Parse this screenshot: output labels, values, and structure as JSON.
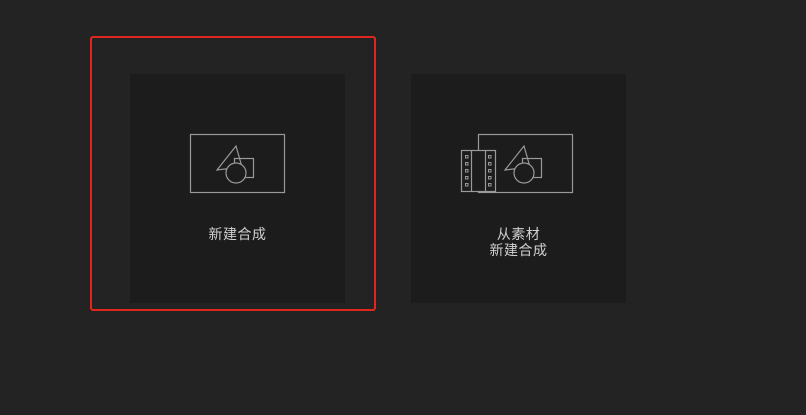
{
  "home": {
    "new_composition": {
      "label": "新建合成",
      "icon": "composition-icon"
    },
    "composition_from_footage": {
      "label_line1": "从素材",
      "label_line2": "新建合成",
      "icon": "footage-composition-icon"
    },
    "colors": {
      "background": "#232323",
      "card": "#1c1c1c",
      "highlight": "#e0271f",
      "text": "#cfcfcf",
      "icon_stroke": "#9a9a9a"
    }
  }
}
